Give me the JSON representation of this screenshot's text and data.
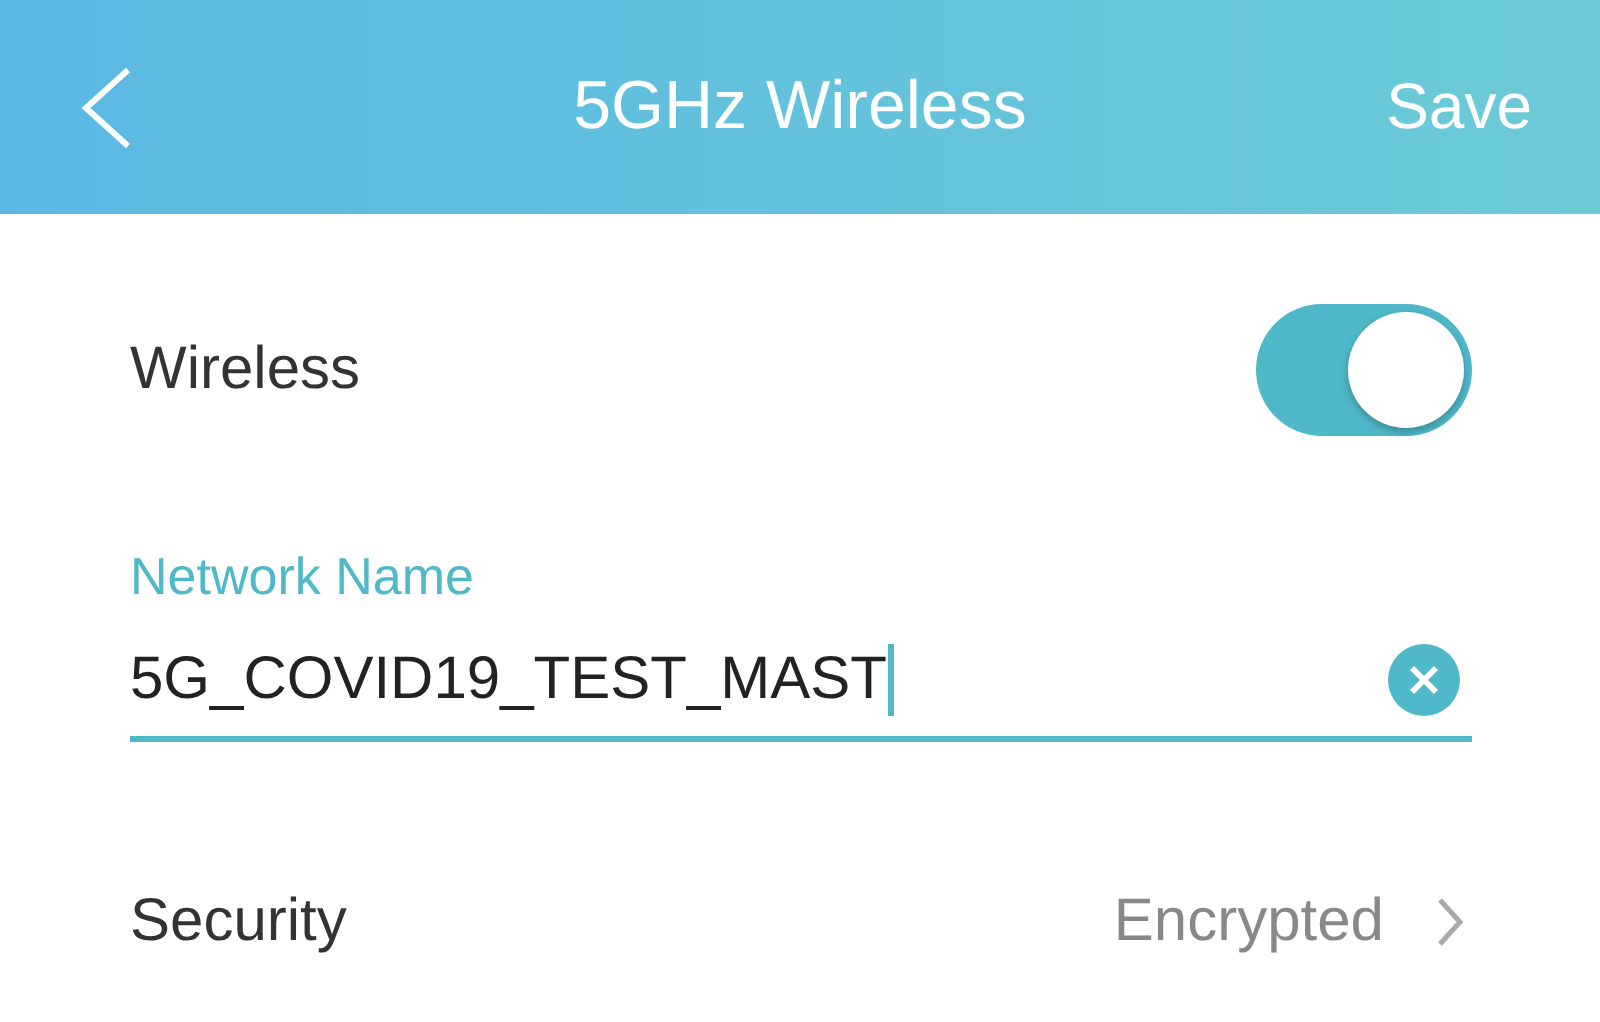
{
  "header": {
    "title": "5GHz Wireless",
    "action": "Save"
  },
  "wireless": {
    "label": "Wireless",
    "on": true
  },
  "network_name": {
    "label": "Network Name",
    "value": "5G_COVID19_TEST_MAST"
  },
  "security": {
    "label": "Security",
    "value": "Encrypted"
  }
}
